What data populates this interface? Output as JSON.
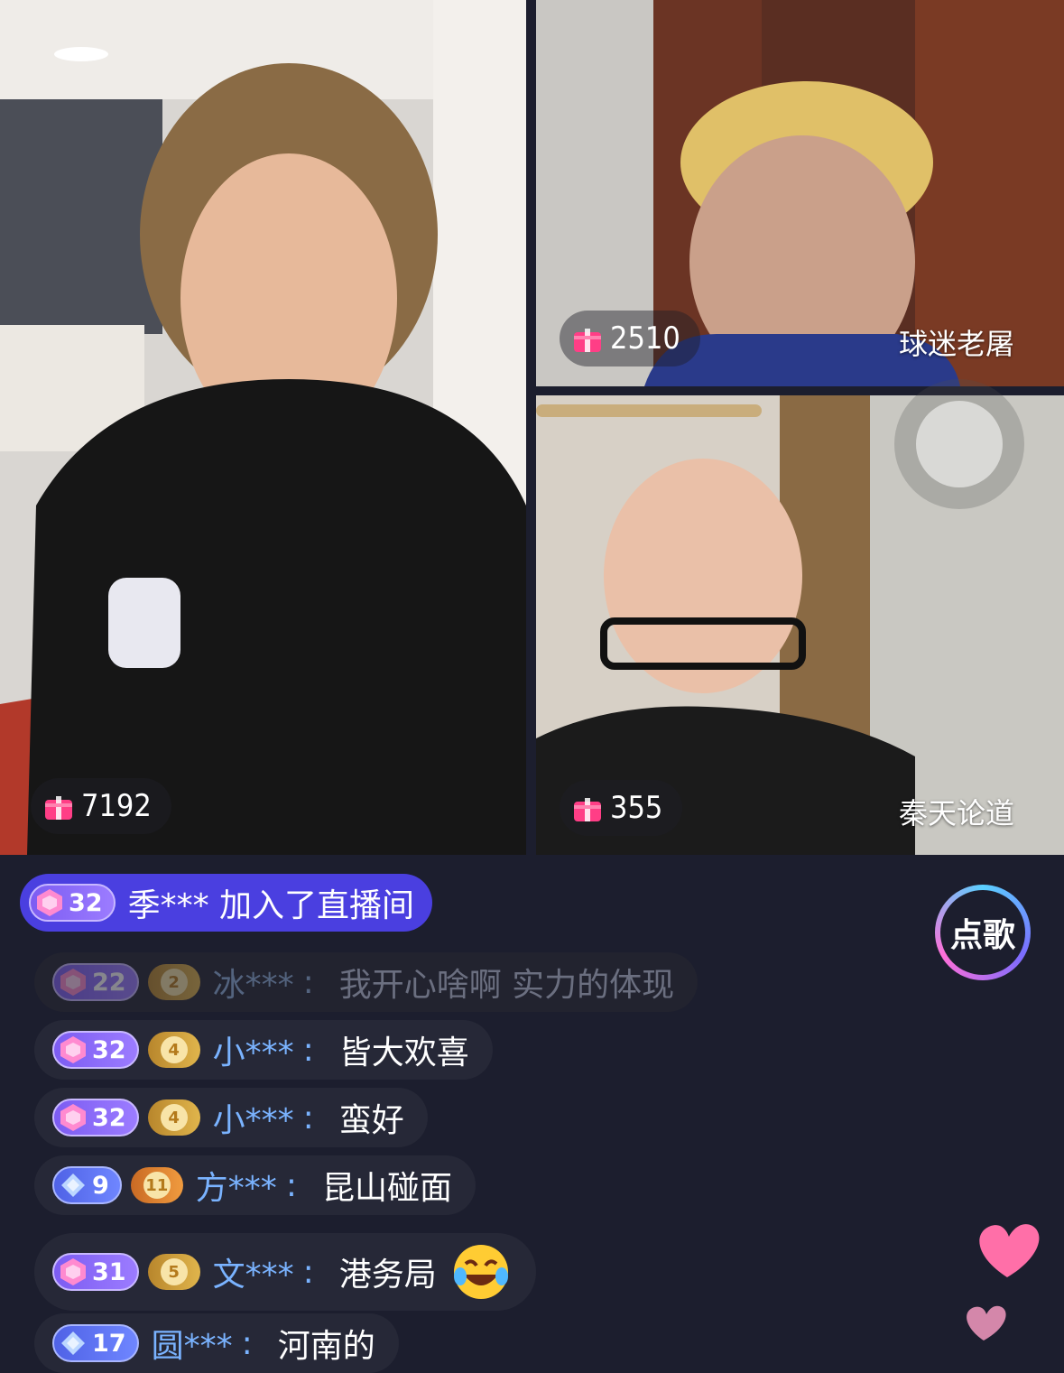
{
  "streams": [
    {
      "gift_count": "7192",
      "name": ""
    },
    {
      "gift_count": "2510",
      "name": "球迷老屠"
    },
    {
      "gift_count": "355",
      "name": "秦天论道"
    }
  ],
  "join": {
    "level": "32",
    "text": "季*** 加入了直播间"
  },
  "messages": [
    {
      "level": "22",
      "fan": "2",
      "user": "冰***",
      "text": "我开心啥啊 实力的体现",
      "dim": true
    },
    {
      "level": "32",
      "fan": "4",
      "user": "小***",
      "text": "皆大欢喜"
    },
    {
      "level": "32",
      "fan": "4",
      "user": "小***",
      "text": "蛮好"
    },
    {
      "level": "9",
      "fan": "11",
      "user": "方***",
      "text": "昆山碰面"
    },
    {
      "level": "31",
      "fan": "5",
      "user": "文***",
      "text": "港务局"
    },
    {
      "level": "17",
      "fan": "",
      "user": "圆***",
      "text": "河南的"
    }
  ],
  "song_button": "点歌",
  "icons": {
    "gift": "gift-icon",
    "level": "gem-icon",
    "fan": "heart-icon",
    "emoji": "laughing-emoji-icon",
    "reaction": "heart-reaction-icon"
  }
}
